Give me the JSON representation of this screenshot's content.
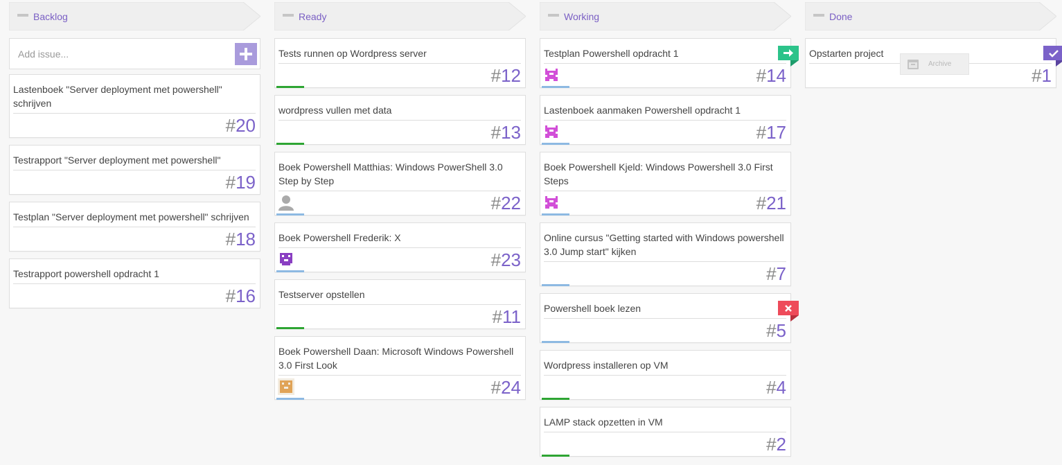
{
  "colors": {
    "accent": "#7b62c9",
    "green": "#2ea533",
    "blue": "#8db9e2",
    "flag_go": "#2cc38a",
    "flag_stop": "#ee4b5a",
    "flag_done": "#7b62c9"
  },
  "columns": [
    {
      "title": "Backlog"
    },
    {
      "title": "Ready"
    },
    {
      "title": "Working"
    },
    {
      "title": "Done"
    }
  ],
  "add_issue": {
    "placeholder": "Add issue..."
  },
  "backlog": [
    {
      "title": "Lastenboek \"Server deployment met powershell\" schrijven",
      "hash": "#",
      "number": "20"
    },
    {
      "title": "Testrapport \"Server deployment met powershell\"",
      "hash": "#",
      "number": "19"
    },
    {
      "title": "Testplan \"Server deployment met powershell\" schrijven",
      "hash": "#",
      "number": "18"
    },
    {
      "title": "Testrapport powershell opdracht 1",
      "hash": "#",
      "number": "16"
    }
  ],
  "ready": [
    {
      "title": "Tests runnen op Wordpress server",
      "hash": "#",
      "number": "12",
      "bar": "green"
    },
    {
      "title": "wordpress vullen met data",
      "hash": "#",
      "number": "13",
      "bar": "green"
    },
    {
      "title": "Boek Powershell Matthias: Windows PowerShell 3.0 Step by Step",
      "hash": "#",
      "number": "22",
      "bar": "blue",
      "avatar": "person-avatar-icon"
    },
    {
      "title": "Boek Powershell Frederik: X",
      "hash": "#",
      "number": "23",
      "bar": "blue",
      "avatar": "purple-identicon-avatar"
    },
    {
      "title": "Testserver opstellen",
      "hash": "#",
      "number": "11",
      "bar": "green"
    },
    {
      "title": "Boek Powershell Daan: Microsoft Windows Powershell 3.0 First Look",
      "hash": "#",
      "number": "24",
      "bar": "blue",
      "avatar": "orange-identicon-avatar"
    }
  ],
  "working": [
    {
      "title": "Testplan Powershell opdracht 1",
      "hash": "#",
      "number": "14",
      "bar": "blue",
      "avatar": "pink-identicon-avatar",
      "flag": "arrow-right-icon"
    },
    {
      "title": "Lastenboek aanmaken Powershell opdracht 1",
      "hash": "#",
      "number": "17",
      "bar": "blue",
      "avatar": "pink-identicon-avatar"
    },
    {
      "title": "Boek Powershell Kjeld: Windows Powershell 3.0 First Steps",
      "hash": "#",
      "number": "21",
      "bar": "blue",
      "avatar": "pink-identicon-avatar"
    },
    {
      "title": "Online cursus \"Getting started with Windows powershell 3.0 Jump start\" kijken",
      "hash": "#",
      "number": "7",
      "bar": "blue"
    },
    {
      "title": "Powershell boek lezen",
      "hash": "#",
      "number": "5",
      "bar": "blue",
      "flag": "close-icon"
    },
    {
      "title": "Wordpress installeren op VM",
      "hash": "#",
      "number": "4",
      "bar": "green"
    },
    {
      "title": "LAMP stack opzetten in VM",
      "hash": "#",
      "number": "2",
      "bar": "green"
    }
  ],
  "done": [
    {
      "title": "Opstarten project",
      "hash": "#",
      "number": "1",
      "flag": "checkmark-icon",
      "archive_label": "Archive"
    }
  ]
}
